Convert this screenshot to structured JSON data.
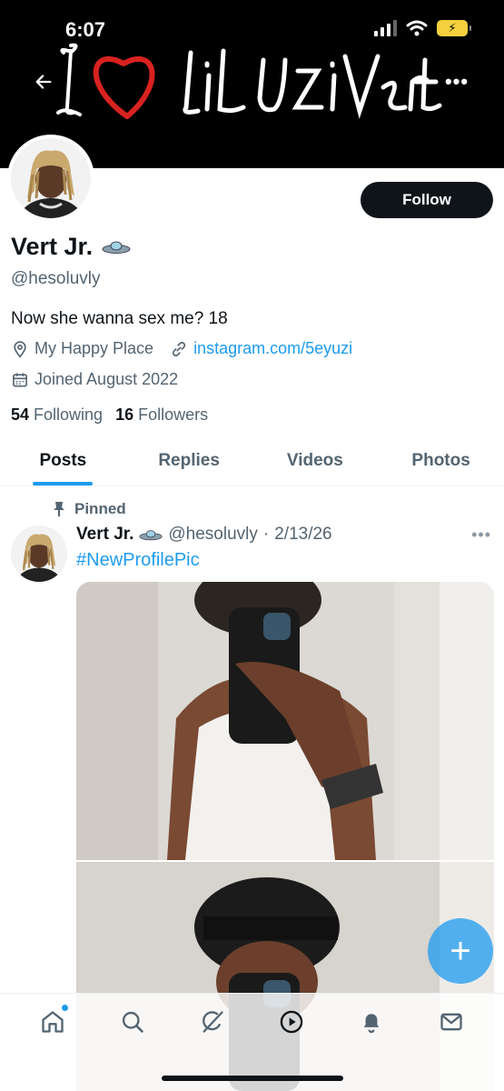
{
  "status_bar": {
    "time": "6:07",
    "battery_icon": "battery-charging-icon",
    "wifi_icon": "wifi-icon",
    "signal_icon": "cellular-signal-icon"
  },
  "banner": {
    "art_text": "I ♥ LiL Uzi Vert",
    "heart_color": "#d8221f"
  },
  "header": {
    "back_icon": "arrow-left-icon",
    "more_icon": "more-icon"
  },
  "profile": {
    "display_name": "Vert Jr.",
    "handle": "@hesoluvly",
    "follow_label": "Follow",
    "bio": "Now she wanna sex me? 18",
    "location": "My Happy Place",
    "link": "instagram.com/5eyuzi",
    "joined": "Joined August 2022",
    "following_count": "54",
    "following_label": "Following",
    "followers_count": "16",
    "followers_label": "Followers"
  },
  "tabs": [
    {
      "label": "Posts",
      "active": true
    },
    {
      "label": "Replies",
      "active": false
    },
    {
      "label": "Videos",
      "active": false
    },
    {
      "label": "Photos",
      "active": false
    }
  ],
  "post": {
    "pinned_label": "Pinned",
    "author_name": "Vert Jr.",
    "author_handle": "@hesoluvly",
    "separator": "·",
    "date": "2/13/26",
    "text": "#NewProfilePic",
    "more_icon": "more-icon"
  },
  "fab": {
    "label": "+"
  },
  "bottom_nav": [
    "home-icon",
    "search-icon",
    "grok-icon",
    "play-icon",
    "bell-icon",
    "mail-icon"
  ],
  "colors": {
    "accent": "#1d9bf0",
    "text": "#0f1419",
    "secondary": "#536471"
  }
}
